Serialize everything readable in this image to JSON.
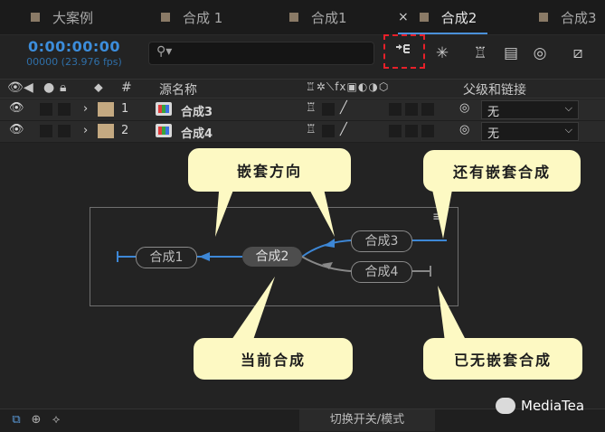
{
  "tabs": [
    {
      "label": "大案例"
    },
    {
      "label": "合成 1"
    },
    {
      "label": "合成1"
    },
    {
      "label": "合成2",
      "active": true
    },
    {
      "label": "合成3"
    }
  ],
  "active_tab_close": "×",
  "timecode": "0:00:00:00",
  "frame_info": "00000 (23.976 fps)",
  "search": {
    "value": "",
    "icon": "search-icon"
  },
  "columns": {
    "source_name": "源名称",
    "number": "#",
    "parent_link": "父级和链接"
  },
  "layers": [
    {
      "number": "1",
      "name": "合成3",
      "parent": "无"
    },
    {
      "number": "2",
      "name": "合成4",
      "parent": "无"
    }
  ],
  "flowchart": {
    "nodes": [
      "合成1",
      "合成2",
      "合成3",
      "合成4"
    ]
  },
  "callouts": {
    "nest_direction": "嵌套方向",
    "more_nested": "还有嵌套合成",
    "current_comp": "当前合成",
    "no_more_nested": "已无嵌套合成"
  },
  "footer": {
    "mode_label": "切换开关/模式"
  },
  "watermark": "MediaTea",
  "colors": {
    "accent": "#3c8ddb",
    "callout_bg": "#fdf9c3",
    "highlight_border": "#e8202a",
    "layer_label": "#c4a981"
  }
}
